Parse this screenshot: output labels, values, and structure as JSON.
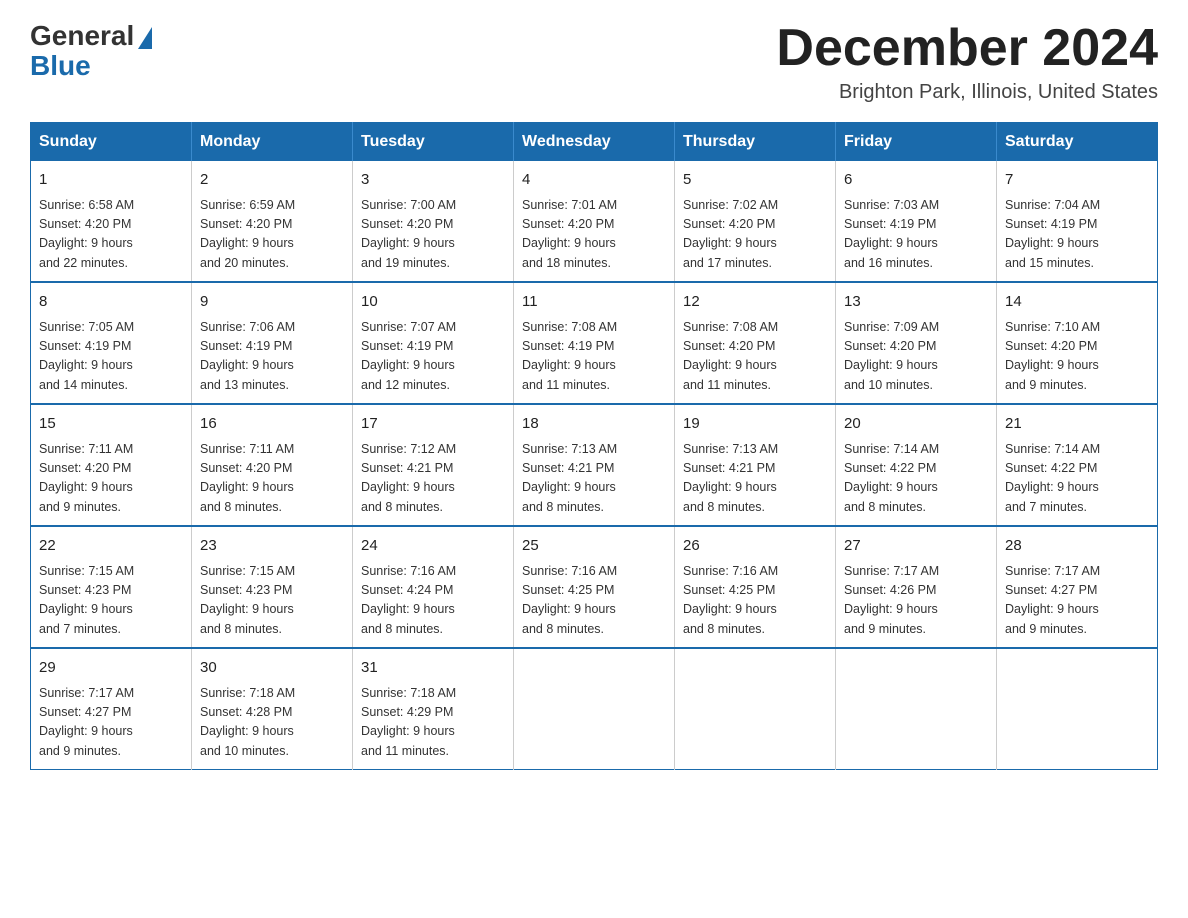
{
  "logo": {
    "general": "General",
    "blue": "Blue"
  },
  "title": {
    "month_year": "December 2024",
    "location": "Brighton Park, Illinois, United States"
  },
  "weekdays": [
    "Sunday",
    "Monday",
    "Tuesday",
    "Wednesday",
    "Thursday",
    "Friday",
    "Saturday"
  ],
  "weeks": [
    [
      {
        "day": "1",
        "sunrise": "6:58 AM",
        "sunset": "4:20 PM",
        "daylight": "9 hours and 22 minutes."
      },
      {
        "day": "2",
        "sunrise": "6:59 AM",
        "sunset": "4:20 PM",
        "daylight": "9 hours and 20 minutes."
      },
      {
        "day": "3",
        "sunrise": "7:00 AM",
        "sunset": "4:20 PM",
        "daylight": "9 hours and 19 minutes."
      },
      {
        "day": "4",
        "sunrise": "7:01 AM",
        "sunset": "4:20 PM",
        "daylight": "9 hours and 18 minutes."
      },
      {
        "day": "5",
        "sunrise": "7:02 AM",
        "sunset": "4:20 PM",
        "daylight": "9 hours and 17 minutes."
      },
      {
        "day": "6",
        "sunrise": "7:03 AM",
        "sunset": "4:19 PM",
        "daylight": "9 hours and 16 minutes."
      },
      {
        "day": "7",
        "sunrise": "7:04 AM",
        "sunset": "4:19 PM",
        "daylight": "9 hours and 15 minutes."
      }
    ],
    [
      {
        "day": "8",
        "sunrise": "7:05 AM",
        "sunset": "4:19 PM",
        "daylight": "9 hours and 14 minutes."
      },
      {
        "day": "9",
        "sunrise": "7:06 AM",
        "sunset": "4:19 PM",
        "daylight": "9 hours and 13 minutes."
      },
      {
        "day": "10",
        "sunrise": "7:07 AM",
        "sunset": "4:19 PM",
        "daylight": "9 hours and 12 minutes."
      },
      {
        "day": "11",
        "sunrise": "7:08 AM",
        "sunset": "4:19 PM",
        "daylight": "9 hours and 11 minutes."
      },
      {
        "day": "12",
        "sunrise": "7:08 AM",
        "sunset": "4:20 PM",
        "daylight": "9 hours and 11 minutes."
      },
      {
        "day": "13",
        "sunrise": "7:09 AM",
        "sunset": "4:20 PM",
        "daylight": "9 hours and 10 minutes."
      },
      {
        "day": "14",
        "sunrise": "7:10 AM",
        "sunset": "4:20 PM",
        "daylight": "9 hours and 9 minutes."
      }
    ],
    [
      {
        "day": "15",
        "sunrise": "7:11 AM",
        "sunset": "4:20 PM",
        "daylight": "9 hours and 9 minutes."
      },
      {
        "day": "16",
        "sunrise": "7:11 AM",
        "sunset": "4:20 PM",
        "daylight": "9 hours and 8 minutes."
      },
      {
        "day": "17",
        "sunrise": "7:12 AM",
        "sunset": "4:21 PM",
        "daylight": "9 hours and 8 minutes."
      },
      {
        "day": "18",
        "sunrise": "7:13 AM",
        "sunset": "4:21 PM",
        "daylight": "9 hours and 8 minutes."
      },
      {
        "day": "19",
        "sunrise": "7:13 AM",
        "sunset": "4:21 PM",
        "daylight": "9 hours and 8 minutes."
      },
      {
        "day": "20",
        "sunrise": "7:14 AM",
        "sunset": "4:22 PM",
        "daylight": "9 hours and 8 minutes."
      },
      {
        "day": "21",
        "sunrise": "7:14 AM",
        "sunset": "4:22 PM",
        "daylight": "9 hours and 7 minutes."
      }
    ],
    [
      {
        "day": "22",
        "sunrise": "7:15 AM",
        "sunset": "4:23 PM",
        "daylight": "9 hours and 7 minutes."
      },
      {
        "day": "23",
        "sunrise": "7:15 AM",
        "sunset": "4:23 PM",
        "daylight": "9 hours and 8 minutes."
      },
      {
        "day": "24",
        "sunrise": "7:16 AM",
        "sunset": "4:24 PM",
        "daylight": "9 hours and 8 minutes."
      },
      {
        "day": "25",
        "sunrise": "7:16 AM",
        "sunset": "4:25 PM",
        "daylight": "9 hours and 8 minutes."
      },
      {
        "day": "26",
        "sunrise": "7:16 AM",
        "sunset": "4:25 PM",
        "daylight": "9 hours and 8 minutes."
      },
      {
        "day": "27",
        "sunrise": "7:17 AM",
        "sunset": "4:26 PM",
        "daylight": "9 hours and 9 minutes."
      },
      {
        "day": "28",
        "sunrise": "7:17 AM",
        "sunset": "4:27 PM",
        "daylight": "9 hours and 9 minutes."
      }
    ],
    [
      {
        "day": "29",
        "sunrise": "7:17 AM",
        "sunset": "4:27 PM",
        "daylight": "9 hours and 9 minutes."
      },
      {
        "day": "30",
        "sunrise": "7:18 AM",
        "sunset": "4:28 PM",
        "daylight": "9 hours and 10 minutes."
      },
      {
        "day": "31",
        "sunrise": "7:18 AM",
        "sunset": "4:29 PM",
        "daylight": "9 hours and 11 minutes."
      },
      null,
      null,
      null,
      null
    ]
  ],
  "labels": {
    "sunrise": "Sunrise:",
    "sunset": "Sunset:",
    "daylight": "Daylight:"
  }
}
